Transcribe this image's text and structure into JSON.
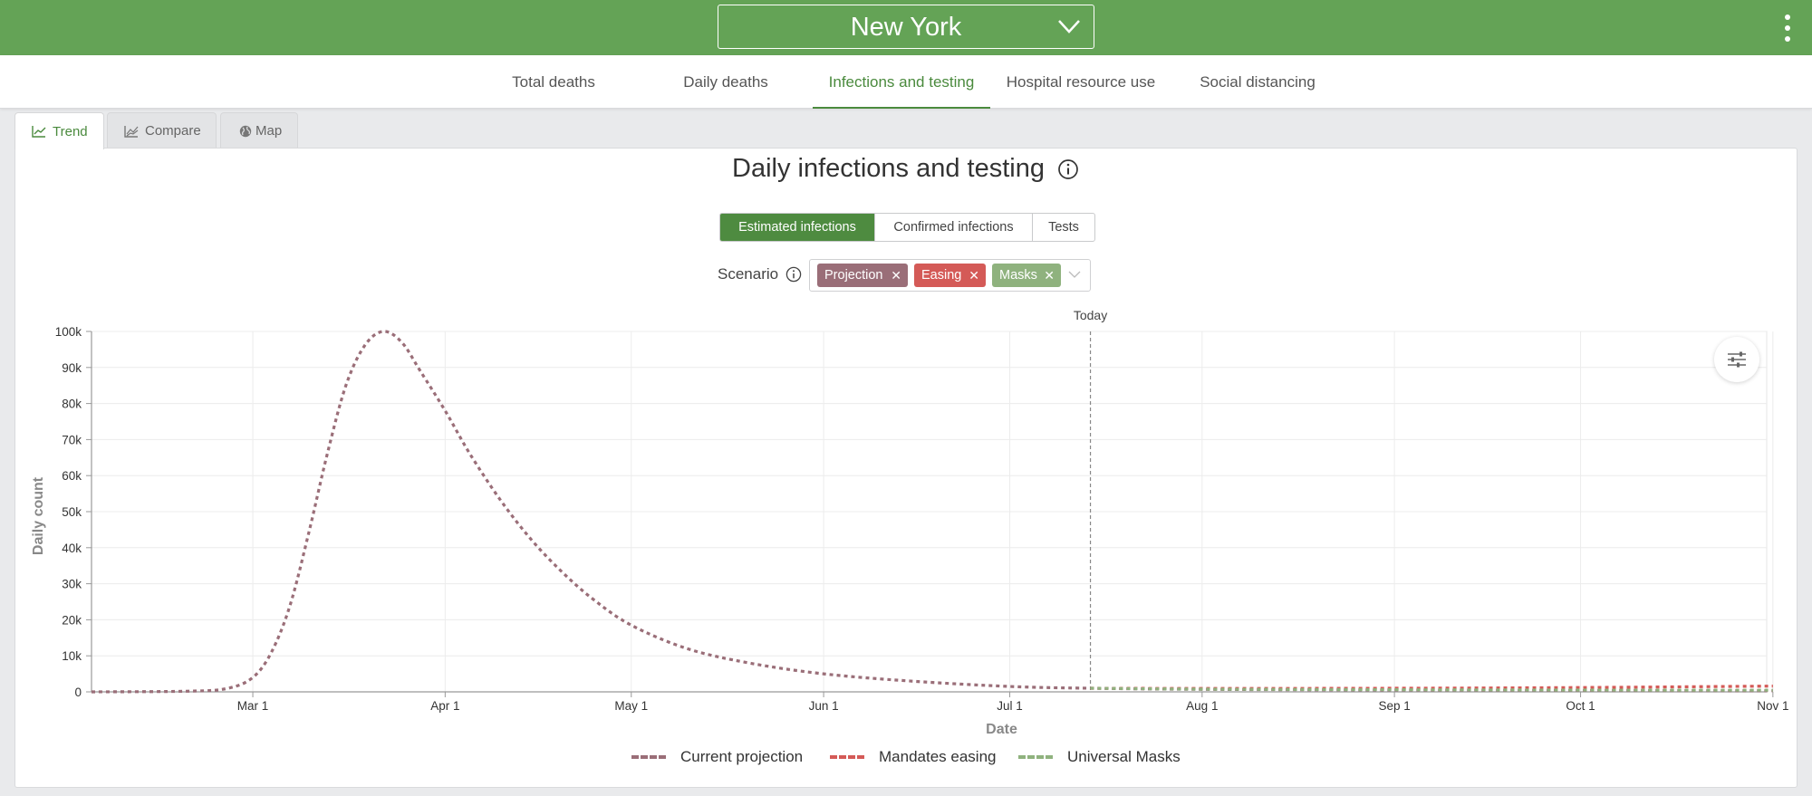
{
  "header": {
    "location": "New York",
    "background": "#64a356"
  },
  "nav": {
    "tabs": [
      {
        "label": "Total deaths",
        "active": false
      },
      {
        "label": "Daily deaths",
        "active": false
      },
      {
        "label": "Infections and testing",
        "active": true
      },
      {
        "label": "Hospital resource use",
        "active": false
      },
      {
        "label": "Social distancing",
        "active": false
      }
    ]
  },
  "views": {
    "tabs": [
      {
        "label": "Trend",
        "icon": "line-chart-icon",
        "active": true
      },
      {
        "label": "Compare",
        "icon": "compare-chart-icon",
        "active": false
      },
      {
        "label": "Map",
        "icon": "globe-icon",
        "active": false
      }
    ]
  },
  "card": {
    "title": "Daily infections and testing",
    "metric_options": [
      {
        "label": "Estimated infections",
        "active": true
      },
      {
        "label": "Confirmed infections",
        "active": false
      },
      {
        "label": "Tests",
        "active": false
      }
    ],
    "scenario_label": "Scenario",
    "scenario_chips": [
      {
        "label": "Projection",
        "color": "#9a6e78"
      },
      {
        "label": "Easing",
        "color": "#d45a57"
      },
      {
        "label": "Masks",
        "color": "#8fb27e"
      }
    ]
  },
  "chart_data": {
    "type": "line",
    "xlabel": "Date",
    "ylabel": "Daily count",
    "y_ticks": [
      "0",
      "10k",
      "20k",
      "30k",
      "40k",
      "50k",
      "60k",
      "70k",
      "80k",
      "90k",
      "100k"
    ],
    "ylim": [
      0,
      100000
    ],
    "x_ticks": [
      "Mar 1",
      "Apr 1",
      "May 1",
      "Jun 1",
      "Jul 1",
      "Aug 1",
      "Sep 1",
      "Oct 1",
      "Nov 1"
    ],
    "today_label": "Today",
    "today": "Jul 14",
    "grid": true,
    "legend_position": "bottom",
    "series": [
      {
        "name": "Current projection",
        "color": "#9a6e78",
        "points": [
          [
            "Feb 4",
            0
          ],
          [
            "Feb 20",
            200
          ],
          [
            "Feb 26",
            1000
          ],
          [
            "Mar 1",
            4000
          ],
          [
            "Mar 4",
            11000
          ],
          [
            "Mar 7",
            24000
          ],
          [
            "Mar 10",
            44000
          ],
          [
            "Mar 13",
            66000
          ],
          [
            "Mar 16",
            85000
          ],
          [
            "Mar 19",
            96000
          ],
          [
            "Mar 22",
            100000
          ],
          [
            "Mar 25",
            97000
          ],
          [
            "Mar 28",
            89000
          ],
          [
            "Apr 1",
            78000
          ],
          [
            "Apr 5",
            66000
          ],
          [
            "Apr 10",
            53000
          ],
          [
            "Apr 15",
            42000
          ],
          [
            "Apr 20",
            33000
          ],
          [
            "Apr 25",
            25500
          ],
          [
            "May 1",
            18500
          ],
          [
            "May 10",
            12000
          ],
          [
            "May 20",
            8000
          ],
          [
            "Jun 1",
            5000
          ],
          [
            "Jun 15",
            3000
          ],
          [
            "Jul 1",
            1500
          ],
          [
            "Jul 14",
            1000
          ],
          [
            "Aug 1",
            700
          ],
          [
            "Sep 1",
            500
          ],
          [
            "Oct 1",
            400
          ],
          [
            "Nov 1",
            300
          ]
        ]
      },
      {
        "name": "Mandates easing",
        "color": "#d45a57",
        "points": [
          [
            "Jul 14",
            1000
          ],
          [
            "Aug 1",
            950
          ],
          [
            "Sep 1",
            1000
          ],
          [
            "Oct 1",
            1200
          ],
          [
            "Nov 1",
            1600
          ]
        ]
      },
      {
        "name": "Universal Masks",
        "color": "#8fb27e",
        "points": [
          [
            "Jul 14",
            1000
          ],
          [
            "Aug 1",
            750
          ],
          [
            "Sep 1",
            600
          ],
          [
            "Oct 1",
            500
          ],
          [
            "Nov 1",
            450
          ]
        ]
      }
    ]
  }
}
